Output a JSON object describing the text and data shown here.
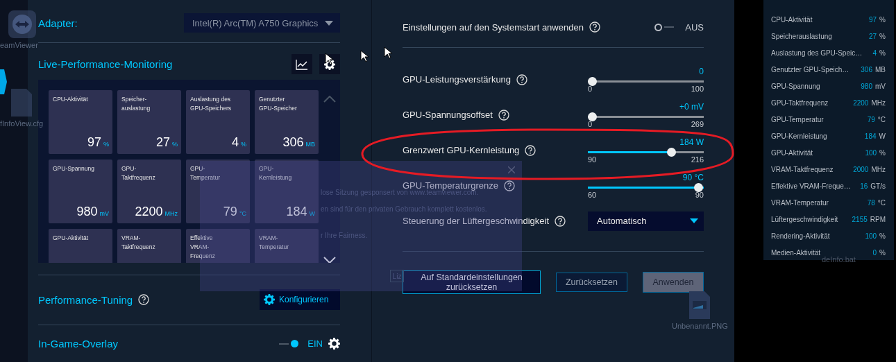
{
  "adapter": {
    "label": "Adapter:",
    "value": "Intel(R) Arc(TM) A750 Graphics"
  },
  "monitoring": {
    "title": "Live-Performance-Monitoring",
    "tiles": [
      {
        "label": "CPU-Aktivität",
        "value": "97",
        "unit": "%"
      },
      {
        "label": "Speicher-\nauslastung",
        "value": "27",
        "unit": "%"
      },
      {
        "label": "Auslastung des\nGPU-Speichers",
        "value": "4",
        "unit": "%"
      },
      {
        "label": "Genutzter\nGPU-Speicher",
        "value": "306",
        "unit": "MB"
      },
      {
        "label": "GPU-Spannung",
        "value": "980",
        "unit": "mV"
      },
      {
        "label": "GPU-\nTaktfrequenz",
        "value": "2200",
        "unit": "MHz"
      },
      {
        "label": "GPU-\nTemperatur",
        "value": "79",
        "unit": "°C"
      },
      {
        "label": "GPU-\nKernleistung",
        "value": "184",
        "unit": "W"
      },
      {
        "label": "GPU-Aktivität"
      },
      {
        "label": "VRAM-\nTaktfrequenz"
      },
      {
        "label": "Effektive\nVRAM-\nFrequenz"
      },
      {
        "label": "VRAM-\nTemperatur"
      }
    ]
  },
  "performance_tuning": {
    "title": "Performance-Tuning",
    "button": "Konfigurieren"
  },
  "in_game_overlay": {
    "title": "In-Game-Overlay",
    "on": true,
    "state_text": "EIN"
  },
  "tuning": {
    "startup": {
      "label": "Einstellungen auf den Systemstart anwenden",
      "on": false,
      "state_text": "AUS"
    },
    "sliders": [
      {
        "label": "GPU-Leistungsverstärkung",
        "value": "0",
        "min": "0",
        "max": "100",
        "level": 0
      },
      {
        "label": "GPU-Spannungsoffset",
        "value": "+0 mV",
        "min": "0",
        "max": "269",
        "level": 0
      },
      {
        "label": "Grenzwert GPU-Kernleistung",
        "value": "184 W",
        "min": "90",
        "max": "216",
        "level": 0.746
      },
      {
        "label": "GPU-Temperaturgrenze",
        "value": "90 °C",
        "min": "60",
        "max": "90",
        "level": 1
      }
    ],
    "fan": {
      "label": "Steuerung der Lüftergeschwindigkeit",
      "value": "Automatisch"
    },
    "buttons": [
      {
        "label": "Auf Standardeinstellungen\nzurücksetzen",
        "kind": "outline"
      },
      {
        "label": "Zurücksetzen",
        "kind": "secondary"
      },
      {
        "label": "Anwenden",
        "kind": "grey"
      }
    ]
  },
  "overlay_panel": {
    "rows": [
      {
        "label": "CPU-Aktivität",
        "value": "97",
        "unit": "%"
      },
      {
        "label": "Speicherauslastung",
        "value": "27",
        "unit": "%"
      },
      {
        "label": "Auslastung des GPU-Speic…",
        "value": "4",
        "unit": "%"
      },
      {
        "label": "Genutzter GPU-Speich…",
        "value": "306",
        "unit": "MB"
      },
      {
        "label": "GPU-Spannung",
        "value": "980",
        "unit": "mV"
      },
      {
        "label": "GPU-Taktfrequenz",
        "value": "2200",
        "unit": "MHz"
      },
      {
        "label": "GPU-Temperatur",
        "value": "79",
        "unit": "°C"
      },
      {
        "label": "GPU-Kernleistung",
        "value": "184",
        "unit": "W"
      },
      {
        "label": "GPU-Aktivität",
        "value": "100",
        "unit": "%"
      },
      {
        "label": "VRAM-Taktfrequenz",
        "value": "2000",
        "unit": "MHz"
      },
      {
        "label": "Effektive VRAM-Freque…",
        "value": "16",
        "unit": "GT/s"
      },
      {
        "label": "VRAM-Temperatur",
        "value": "78",
        "unit": "°C"
      },
      {
        "label": "Lüftergeschwindigkeit",
        "value": "2155",
        "unit": "RPM"
      },
      {
        "label": "Rendering-Aktivität",
        "value": "100",
        "unit": "%"
      },
      {
        "label": "Medien-Aktivität",
        "value": "0",
        "unit": "%"
      }
    ]
  },
  "popup": {
    "lines": [
      "lose Sitzung gesponsert von www.teamviewer.com.",
      "en sind für den privaten Gebrauch komplett kostenlos.",
      "r Ihre Fairness."
    ],
    "button": "Liz"
  },
  "desktop_icons": [
    {
      "label": "eamViewer",
      "kind": "app"
    },
    {
      "label": "fInfoView.cfg",
      "kind": "file"
    },
    {
      "label": "Unbenannt.PNG",
      "kind": "image"
    },
    {
      "label": "deInfo.bat",
      "kind": "none"
    }
  ]
}
